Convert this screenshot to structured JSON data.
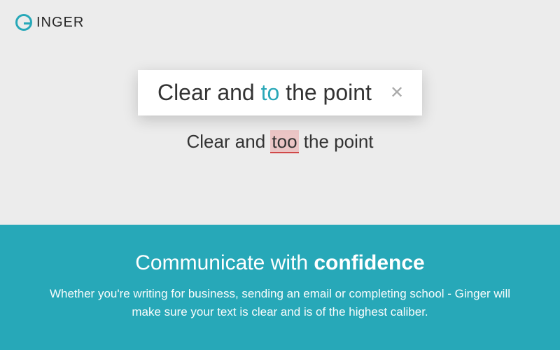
{
  "brand": {
    "name": "INGER"
  },
  "correction": {
    "before": "Clear and ",
    "highlight": "to",
    "after": " the point"
  },
  "original": {
    "before": "Clear and ",
    "error": "too",
    "after": " the point"
  },
  "footer": {
    "title_prefix": "Communicate with ",
    "title_bold": "confidence",
    "body": "Whether you're writing for business, sending an email or completing school - Ginger will make sure your text is clear and is of the highest caliber."
  }
}
